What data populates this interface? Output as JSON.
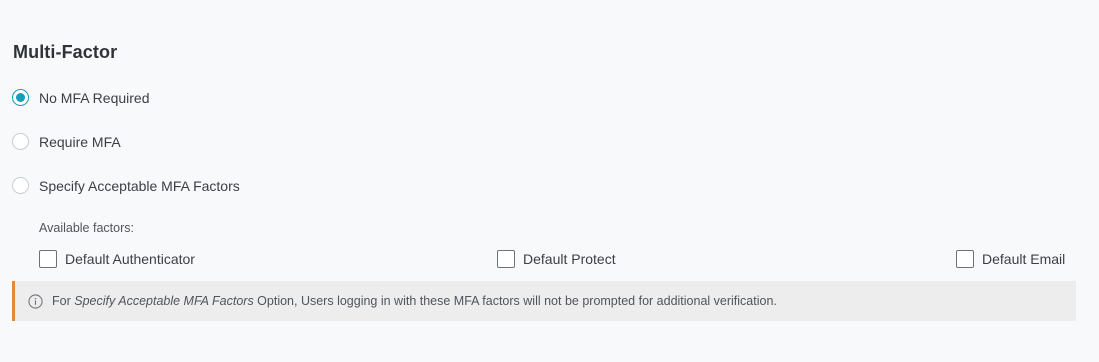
{
  "section": {
    "title": "Multi-Factor"
  },
  "mfa_options": {
    "selected": "no_mfa",
    "items": [
      {
        "id": "no_mfa",
        "label": "No MFA Required",
        "checked": true
      },
      {
        "id": "require_mfa",
        "label": "Require MFA",
        "checked": false
      },
      {
        "id": "specify_factors",
        "label": "Specify Acceptable MFA Factors",
        "checked": false
      }
    ]
  },
  "factors": {
    "label": "Available factors:",
    "items": [
      {
        "label": "Default Authenticator",
        "checked": false
      },
      {
        "label": "Default Protect",
        "checked": false
      },
      {
        "label": "Default Email",
        "checked": false
      }
    ]
  },
  "info": {
    "icon": "info-icon",
    "prefix": "For ",
    "emphasis": "Specify Acceptable MFA Factors",
    "suffix": " Option, Users logging in with these MFA factors will not be prompted for additional verification.",
    "accent_color": "#e08a3a"
  },
  "colors": {
    "radio_selected": "#1a9bb8",
    "background": "#f8f9fb",
    "info_background": "#ededee"
  }
}
